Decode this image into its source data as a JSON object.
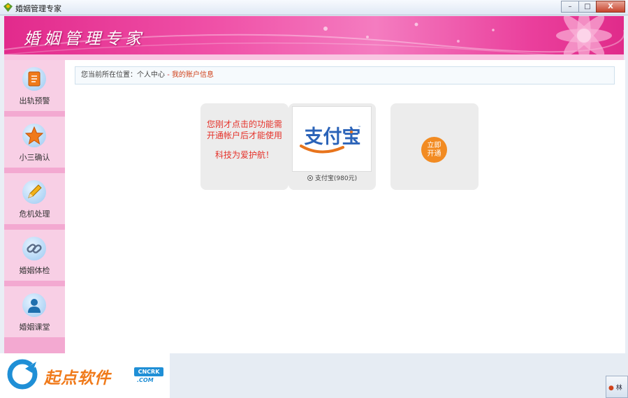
{
  "window": {
    "title": "婚姻管理专家",
    "buttons": {
      "minimize": "–",
      "maximize": "□",
      "close": "X"
    }
  },
  "banner": {
    "brand": "婚姻管理专家"
  },
  "sidebar": {
    "items": [
      {
        "label": "出轨预警",
        "icon": "document-icon"
      },
      {
        "label": "小三确认",
        "icon": "star-icon"
      },
      {
        "label": "危机处理",
        "icon": "pencil-icon"
      },
      {
        "label": "婚姻体检",
        "icon": "link-icon"
      },
      {
        "label": "婚姻课堂",
        "icon": "user-icon"
      }
    ]
  },
  "breadcrumb": {
    "prefix": "您当前所在位置：",
    "parent": "个人中心",
    "separator": "-",
    "current": "我的账户信息"
  },
  "notice": {
    "line1": "您刚才点击的功能需",
    "line2": "开通帐户后才能使用",
    "slogan": "科技为爱护航！"
  },
  "payment": {
    "logo_text": "支付宝",
    "option_label": "支付宝(980元)"
  },
  "open_button": {
    "line1": "立即",
    "line2": "开通"
  },
  "watermark": {
    "name": "起点软件",
    "badge": "CNCRK",
    "domain": ".COM"
  },
  "tray": {
    "label": "林"
  },
  "colors": {
    "banner": "#e22a8c",
    "sidebar": "#f8cfe5",
    "notice_text": "#e5322a",
    "open_button": "#f28b22",
    "alipay_blue": "#2b63b8"
  }
}
